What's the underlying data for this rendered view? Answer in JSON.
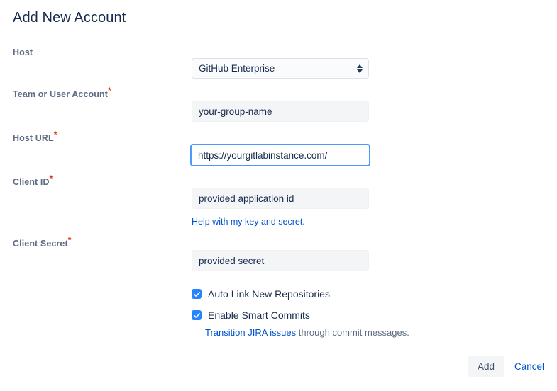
{
  "title": "Add New Account",
  "colors": {
    "title_text": "#172b4d",
    "label_text": "#5e6c84",
    "required_asterisk": "#de350b",
    "link_blue": "#0052cc",
    "focus_border": "#4c9aff",
    "checkbox_blue": "#2684ff",
    "field_background": "#f4f5f7",
    "page_background": "#ffffff"
  },
  "fields": {
    "host": {
      "label": "Host",
      "required": false,
      "selected_option": "GitHub Enterprise",
      "options": [
        "GitHub Enterprise"
      ]
    },
    "team_or_user_account": {
      "label": "Team or User Account",
      "required": true,
      "required_marker": "*",
      "value": "your-group-name",
      "placeholder": "your-group-name"
    },
    "host_url": {
      "label": "Host URL",
      "required": true,
      "required_marker": "*",
      "value": "https://yourgitlabinstance.com/",
      "placeholder": "https://yourgitlabinstance.com/",
      "focused": true
    },
    "client_id": {
      "label": "Client ID",
      "required": true,
      "required_marker": "*",
      "value": "provided application id",
      "placeholder": "provided application id",
      "help_link": "Help with my key and secret."
    },
    "client_secret": {
      "label": "Client Secret",
      "required": true,
      "required_marker": "*",
      "value": "provided secret",
      "placeholder": "provided secret"
    }
  },
  "checkboxes": [
    {
      "label": "Auto Link New Repositories",
      "checked": true
    },
    {
      "label": "Enable Smart Commits",
      "checked": true
    }
  ],
  "smart_commits_hint": {
    "link_text": "Transition JIRA issues",
    "rest_text": " through commit messages."
  },
  "footer": {
    "add_label": "Add",
    "cancel_label": "Cancel"
  }
}
